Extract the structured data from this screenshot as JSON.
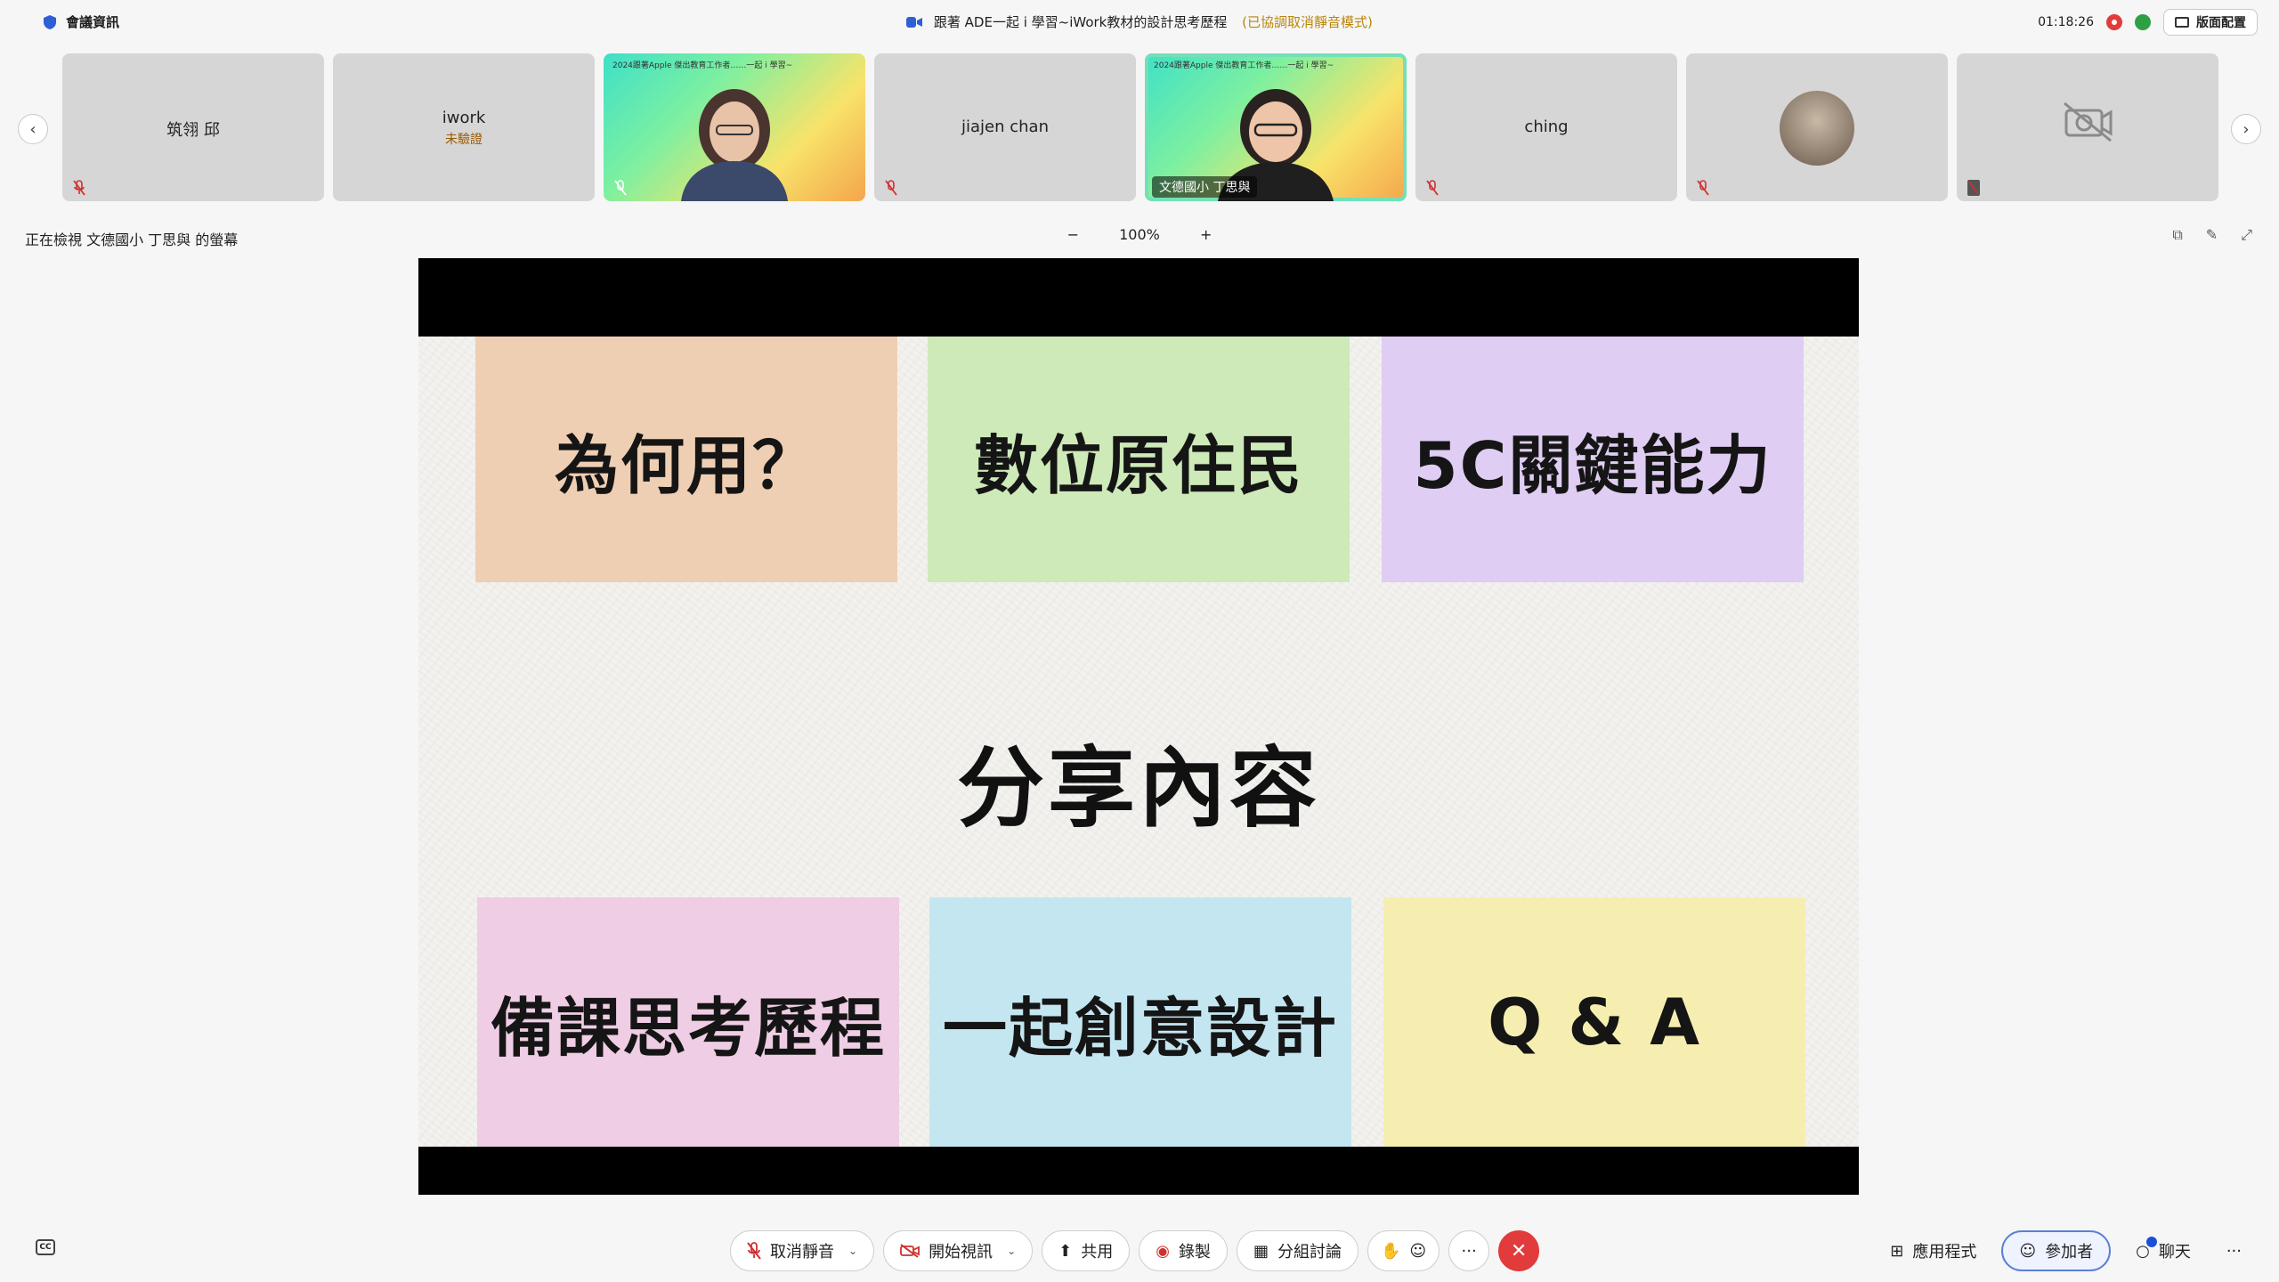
{
  "topbar": {
    "meeting_info": "會議資訊",
    "title": "跟著 ADE一起 i 學習~iWork教材的設計思考歷程",
    "mode_note": "(已協調取消靜音模式)",
    "timer": "01:18:26",
    "layout_button": "版面配置"
  },
  "gallery": {
    "tiles": [
      {
        "name": "筑翎 邱",
        "sub": "",
        "type": "name"
      },
      {
        "name": "iwork",
        "sub": "未驗證",
        "type": "name"
      },
      {
        "name": "",
        "sub": "",
        "type": "video",
        "banner": "2024跟著Apple 傑出教育工作者……一起 i 學習~"
      },
      {
        "name": "jiajen chan",
        "sub": "",
        "type": "name"
      },
      {
        "name": "文德國小 丁思與",
        "sub": "",
        "type": "video-active",
        "banner": "2024跟著Apple 傑出教育工作者……一起 i 學習~"
      },
      {
        "name": "ching",
        "sub": "",
        "type": "name"
      },
      {
        "name": "",
        "sub": "",
        "type": "avatar"
      },
      {
        "name": "",
        "sub": "",
        "type": "cam-off"
      }
    ]
  },
  "share": {
    "label": "正在檢視 文德國小 丁思與 的螢幕",
    "zoom_minus": "−",
    "zoom_level": "100%",
    "zoom_plus": "+"
  },
  "slide": {
    "center_title": "分享內容",
    "cards": [
      {
        "text": "為何用？",
        "color": "#efcfb3"
      },
      {
        "text": "數位原住民",
        "color": "#cdeab8"
      },
      {
        "text": "5C關鍵能力",
        "color": "#dfcdf3"
      },
      {
        "text": "備課思考歷程",
        "color": "#efcde4"
      },
      {
        "text": "一起創意設計",
        "color": "#c4e6f1"
      },
      {
        "text": "Q & A",
        "color": "#f6eeb1"
      }
    ]
  },
  "toolbar": {
    "unmute": "取消靜音",
    "start_video": "開始視訊",
    "share": "共用",
    "record": "錄製",
    "breakout": "分組討論",
    "more": "···",
    "apps": "應用程式",
    "participants": "參加者",
    "chat": "聊天",
    "more_right": "···",
    "cc": "CC"
  },
  "colors": {
    "end_call": "#e23b3b",
    "active_outline": "#74e0b8",
    "participants_border": "#5b7fd6"
  }
}
